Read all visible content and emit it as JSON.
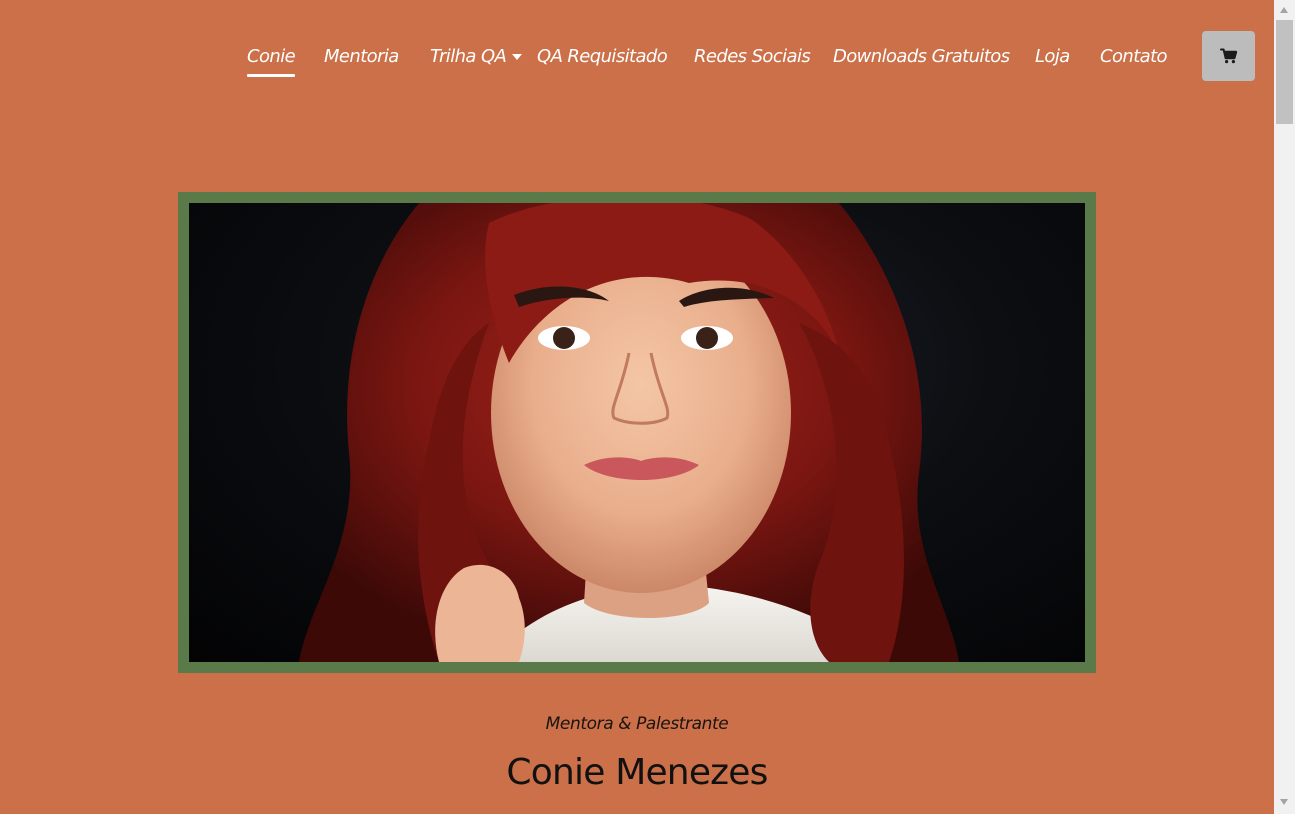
{
  "nav": {
    "items": [
      {
        "label": "Conie",
        "active": true
      },
      {
        "label": "Mentoria"
      },
      {
        "label": "Trilha QA",
        "has_dropdown": true
      },
      {
        "label": "QA Requisitado"
      },
      {
        "label": "Redes Sociais"
      },
      {
        "label": "Downloads Gratuitos"
      },
      {
        "label": "Loja"
      },
      {
        "label": "Contato"
      }
    ],
    "cart_icon": "shopping-cart-icon"
  },
  "hero": {
    "image": "portrait-photo",
    "subtitle": "Mentora &  Palestrante",
    "name": "Conie Menezes"
  },
  "colors": {
    "background": "#cb7048",
    "frame": "#5b7a4a",
    "nav_text": "#ffffff",
    "cart_button": "#bcbcbc"
  }
}
